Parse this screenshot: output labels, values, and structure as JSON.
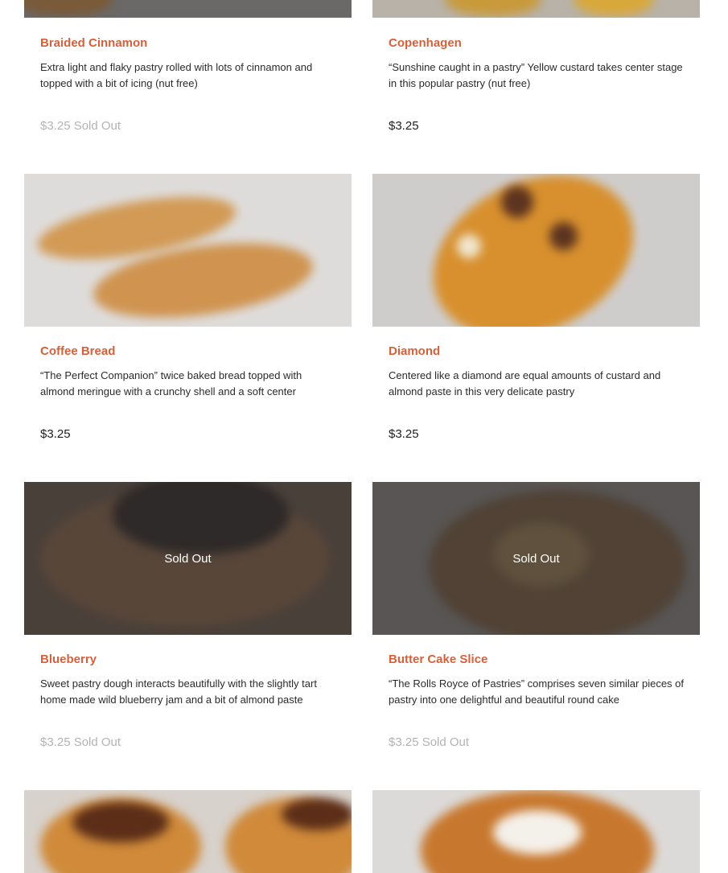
{
  "products": [
    {
      "name": "Braided Cinnamon",
      "description": "Extra light and flaky pastry rolled with lots of cinnamon and topped with a bit of icing (nut free)",
      "price": "$3.25 Sold Out",
      "sold_out": true
    },
    {
      "name": "Copenhagen",
      "description": "“Sunshine caught in a pastry” Yellow custard takes center stage in this popular pastry (nut free)",
      "price": "$3.25",
      "sold_out": false
    },
    {
      "name": "Coffee Bread",
      "description": "“The Perfect Companion” twice baked bread topped with almond meringue with a crunchy shell and a soft center",
      "price": "$3.25",
      "sold_out": false
    },
    {
      "name": "Diamond",
      "description": "Centered like a diamond are equal amounts of custard and almond paste in this very delicate pastry",
      "price": "$3.25",
      "sold_out": false
    },
    {
      "name": "Blueberry",
      "description": "Sweet pastry dough interacts beautifully with the slightly tart home made wild blueberry jam and a bit of almond paste",
      "price": "$3.25 Sold Out",
      "sold_out": true,
      "overlay_label": "Sold Out"
    },
    {
      "name": "Butter Cake Slice",
      "description": "“The Rolls Royce of Pastries” comprises seven similar pieces of pastry into one delightful and beautiful round cake",
      "price": "$3.25 Sold Out",
      "sold_out": true,
      "overlay_label": "Sold Out"
    }
  ],
  "colors": {
    "title": "#d6603a",
    "price": "#1e1e1e",
    "sold_out_price": "#b3b3b3"
  }
}
